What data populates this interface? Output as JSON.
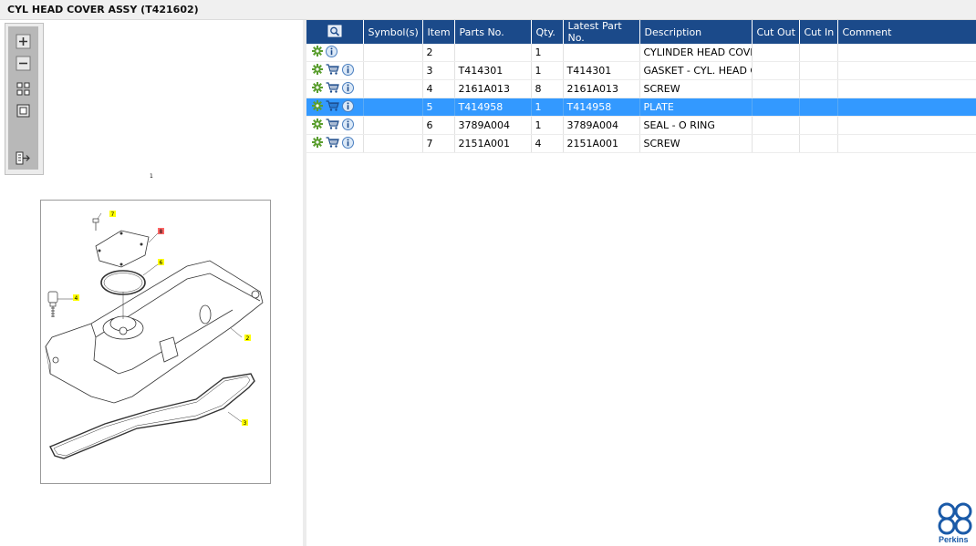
{
  "window": {
    "title": "CYL HEAD COVER ASSY (T421602)"
  },
  "toolbar": {
    "buttons": [
      {
        "name": "zoom-in-button",
        "icon": "zoom-in-icon"
      },
      {
        "name": "zoom-out-button",
        "icon": "zoom-out-icon"
      },
      {
        "name": "fit-all-button",
        "icon": "fit-all-icon"
      },
      {
        "name": "fit-window-button",
        "icon": "fit-window-icon"
      },
      {
        "name": "export-button",
        "icon": "export-icon"
      }
    ]
  },
  "drawing": {
    "top_callout": "1",
    "callouts": [
      "7",
      "8",
      "6",
      "4",
      "2",
      "3"
    ],
    "colors": {
      "callout_bg": "#ffff00",
      "selected_callout_bg": "#ff6666"
    }
  },
  "table": {
    "columns": [
      "",
      "Symbol(s)",
      "Item",
      "Parts No.",
      "Qty.",
      "Latest Part No.",
      "Description",
      "Cut Out",
      "Cut In",
      "Comment"
    ],
    "header_icon": "search-icon",
    "rows": [
      {
        "icons": [
          "gear-icon",
          "info-icon"
        ],
        "symbols": "",
        "item": "2",
        "part_no": "",
        "qty": "1",
        "latest": "",
        "description": "CYLINDER HEAD COVER",
        "cut_out": "",
        "cut_in": "",
        "comment": "",
        "selected": false
      },
      {
        "icons": [
          "gear-icon",
          "cart-icon",
          "info-icon"
        ],
        "symbols": "",
        "item": "3",
        "part_no": "T414301",
        "qty": "1",
        "latest": "T414301",
        "description": "GASKET - CYL. HEAD CO",
        "cut_out": "",
        "cut_in": "",
        "comment": "",
        "selected": false
      },
      {
        "icons": [
          "gear-icon",
          "cart-icon",
          "info-icon"
        ],
        "symbols": "",
        "item": "4",
        "part_no": "2161A013",
        "qty": "8",
        "latest": "2161A013",
        "description": "SCREW",
        "cut_out": "",
        "cut_in": "",
        "comment": "",
        "selected": false
      },
      {
        "icons": [
          "gear-icon",
          "cart-icon",
          "info-icon"
        ],
        "symbols": "",
        "item": "5",
        "part_no": "T414958",
        "qty": "1",
        "latest": "T414958",
        "description": "PLATE",
        "cut_out": "",
        "cut_in": "",
        "comment": "",
        "selected": true
      },
      {
        "icons": [
          "gear-icon",
          "cart-icon",
          "info-icon"
        ],
        "symbols": "",
        "item": "6",
        "part_no": "3789A004",
        "qty": "1",
        "latest": "3789A004",
        "description": "SEAL - O RING",
        "cut_out": "",
        "cut_in": "",
        "comment": "",
        "selected": false
      },
      {
        "icons": [
          "gear-icon",
          "cart-icon",
          "info-icon"
        ],
        "symbols": "",
        "item": "7",
        "part_no": "2151A001",
        "qty": "4",
        "latest": "2151A001",
        "description": "SCREW",
        "cut_out": "",
        "cut_in": "",
        "comment": "",
        "selected": false
      }
    ]
  },
  "brand": {
    "name": "Perkins",
    "color": "#1a5aa8"
  },
  "colors": {
    "header_bg": "#1b4a8a",
    "selected_row_bg": "#3399ff"
  }
}
